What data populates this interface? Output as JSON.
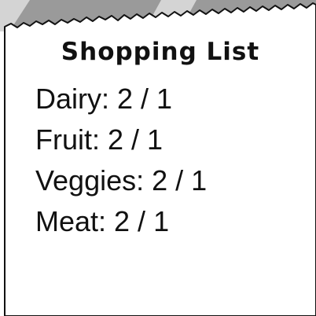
{
  "shopping_list": {
    "title": "Shopping List",
    "items": [
      {
        "category": "Dairy",
        "collected": "2",
        "required": "1",
        "text": "Dairy: 2 / 1"
      },
      {
        "category": "Fruit",
        "collected": "2",
        "required": "1",
        "text": "Fruit: 2 / 1"
      },
      {
        "category": "Veggies",
        "collected": "2",
        "required": "1",
        "text": "Veggies: 2 / 1"
      },
      {
        "category": "Meat",
        "collected": "2",
        "required": "1",
        "text": "Meat: 2 / 1"
      }
    ]
  },
  "colors": {
    "paper": "#ffffff",
    "paper_outline": "#111111",
    "backdrop_gray": "#9a9a9a",
    "backdrop_highlight": "#d4d4d4",
    "text": "#111111"
  }
}
